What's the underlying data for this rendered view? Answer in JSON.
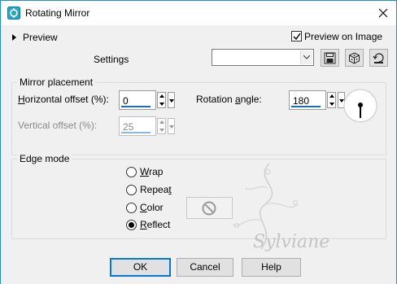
{
  "window": {
    "title": "Rotating Mirror",
    "close_glyph": "✕"
  },
  "preview": {
    "label": "Preview",
    "checkbox_label": "Preview on Image",
    "checked": true
  },
  "settings": {
    "label": "Settings",
    "value": ""
  },
  "toolbar_icons": [
    "save-icon",
    "randomize-icon",
    "reset-icon"
  ],
  "mirror_placement": {
    "title": "Mirror placement",
    "horizontal_offset": {
      "label_u": "H",
      "label_rest": "orizontal offset (%):",
      "value": "0"
    },
    "vertical_offset": {
      "label": "Vertical offset (%):",
      "value": "25",
      "disabled": true
    },
    "rotation_angle": {
      "label_a": "Rotation ",
      "label_u": "a",
      "label_b": "ngle:",
      "value": "180"
    }
  },
  "edge_mode": {
    "title": "Edge mode",
    "options": [
      {
        "u": "W",
        "rest": "rap",
        "selected": false
      },
      {
        "pre": "Repea",
        "u": "t",
        "rest": "",
        "selected": false
      },
      {
        "u": "C",
        "rest": "olor",
        "selected": false
      },
      {
        "u": "R",
        "rest": "eflect",
        "selected": true
      }
    ]
  },
  "watermark": "Sylviane",
  "buttons": {
    "ok": "OK",
    "cancel": "Cancel",
    "help": "Help"
  },
  "colors": {
    "accent": "#0078d7",
    "border": "#1e8fd6",
    "face": "#f0f0f0"
  }
}
